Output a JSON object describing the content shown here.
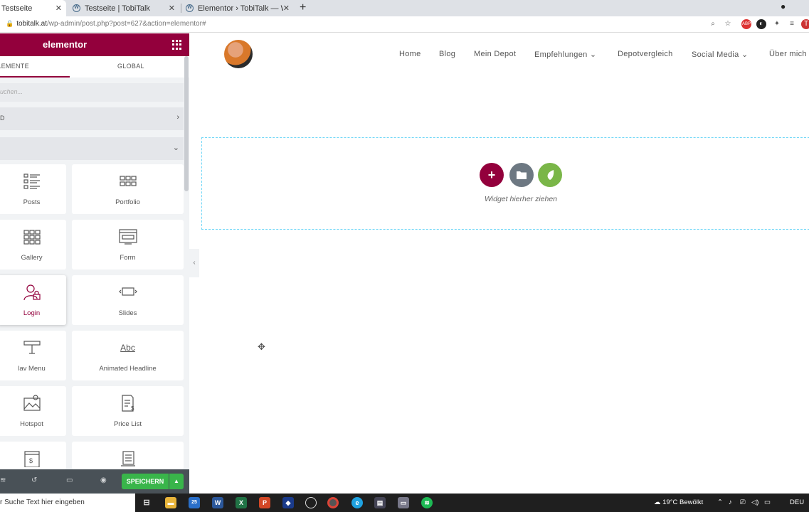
{
  "browser": {
    "tabs": [
      {
        "label": "Testseite",
        "active": true
      },
      {
        "label": "Testseite | TobiTalk",
        "active": false
      },
      {
        "label": "Elementor › TobiTalk — WordPre",
        "active": false
      }
    ],
    "close_glyph": "✕",
    "new_tab_glyph": "+",
    "url_host": "tobitalk.at",
    "url_path": "/wp-admin/post.php?post=627&action=elementor#"
  },
  "panel": {
    "logo_text": "elementor",
    "tab_elements": "ELEMENTE",
    "tab_global": "GLOBAL",
    "search_placeholder": "Suchen...",
    "category_1": "PRO",
    "category_1_visible": "D",
    "widgets": [
      {
        "label": "Posts",
        "icon": "posts-icon"
      },
      {
        "label": "Portfolio",
        "icon": "portfolio-icon"
      },
      {
        "label": "Gallery",
        "icon": "gallery-icon"
      },
      {
        "label": "Form",
        "icon": "form-icon"
      },
      {
        "label": "Login",
        "icon": "login-icon"
      },
      {
        "label": "Slides",
        "icon": "slides-icon"
      },
      {
        "label": "Nav Menu",
        "icon": "nav-menu-icon"
      },
      {
        "label": "Animated Headline",
        "icon": "animated-headline-icon"
      },
      {
        "label": "Hotspot",
        "icon": "hotspot-icon"
      },
      {
        "label": "Price List",
        "icon": "price-list-icon"
      }
    ],
    "visible_labels": {
      "posts": "Posts",
      "portfolio": "Portfolio",
      "gallery": "Gallery",
      "form": "Form",
      "login": "Login",
      "slides": "Slides",
      "nav_menu": "lav Menu",
      "animated_headline": "Animated Headline",
      "hotspot": "Hotspot",
      "price_list": "Price List"
    },
    "save_label": "SPEICHERN",
    "colors": {
      "brand": "#93003c",
      "save": "#39b54a",
      "footer": "#495157"
    }
  },
  "site": {
    "nav": [
      "Home",
      "Blog",
      "Mein Depot",
      "Empfehlungen",
      "Depotvergleich",
      "Social Media",
      "Über mich"
    ],
    "drop_text": "Widget hierher ziehen",
    "buttons": {
      "add": "+",
      "add_color": "#93003c",
      "template_color": "#6d7882",
      "envato_color": "#7ab648"
    }
  },
  "taskbar": {
    "search_text": "r Suche Text hier eingeben",
    "mail_badge": "25",
    "weather": "19°C  Bewölkt",
    "lang": "DEU"
  }
}
